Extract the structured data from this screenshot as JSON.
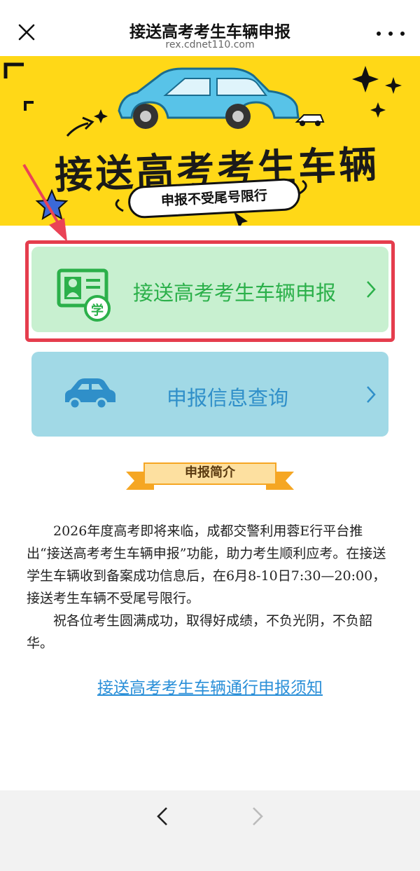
{
  "header": {
    "title": "接送高考考生车辆申报",
    "url": "rex.cdnet110.com"
  },
  "banner": {
    "headline": "接送高考考生车辆",
    "pill_text": "申报不受尾号限行"
  },
  "menu": {
    "apply_label": "接送高考考生车辆申报",
    "apply_badge": "学",
    "query_label": "申报信息查询"
  },
  "intro": {
    "ribbon": "申报简介",
    "paragraph1": "2026年度高考即将来临，成都交警利用蓉E行平台推出“接送高考考生车辆申报”功能，助力考生顺利应考。在接送学生车辆收到备案成功信息后，在6月8-10日7:30—20:00，接送考生车辆不受尾号限行。",
    "paragraph2": "祝各位考生圆满成功，取得好成绩，不负光阴，不负韶华。"
  },
  "notice_link": "接送高考考生车辆通行申报须知",
  "colors": {
    "banner_bg": "#ffd817",
    "apply_card": "#c8f0d0",
    "apply_text": "#2bb04a",
    "query_card": "#a1d9e6",
    "query_text": "#2f8fc9",
    "highlight_border": "#e53d4d",
    "link": "#2a8fd8"
  },
  "icons": [
    "close-icon",
    "more-icon",
    "id-card-icon",
    "car-icon",
    "chevron-right-icon",
    "back-icon",
    "forward-icon"
  ]
}
